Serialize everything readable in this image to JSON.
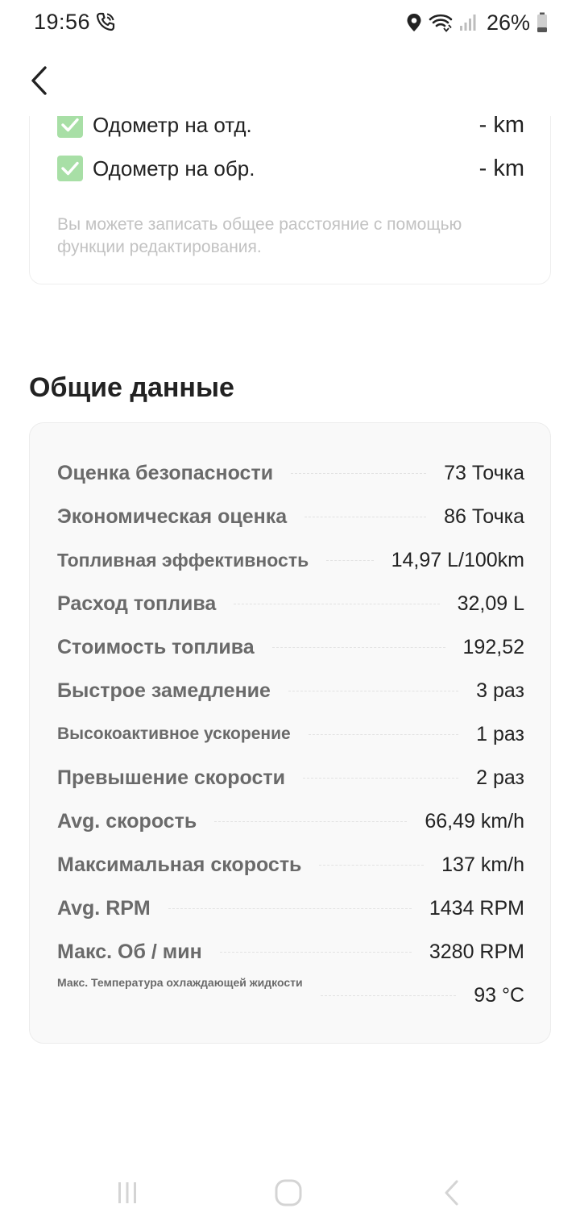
{
  "status_bar": {
    "time": "19:56",
    "battery": "26%"
  },
  "odometer": {
    "rows": [
      {
        "label": "Одометр на отд.",
        "value": "- km"
      },
      {
        "label": "Одометр на обр.",
        "value": "- km"
      }
    ],
    "hint": "Вы можете записать общее расстояние с помощью функции редактирования."
  },
  "general": {
    "title": "Общие данные",
    "rows": [
      {
        "label": "Оценка безопасности",
        "value": "73 Точка"
      },
      {
        "label": "Экономическая оценка",
        "value": "86 Точка"
      },
      {
        "label": "Топливная эффективность",
        "value": "14,97 L/100km"
      },
      {
        "label": "Расход топлива",
        "value": "32,09 L"
      },
      {
        "label": "Стоимость топлива",
        "value": "192,52"
      },
      {
        "label": "Быстрое замедление",
        "value": "3 раз"
      },
      {
        "label": "Высокоактивное ускорение",
        "value": "1 раз"
      },
      {
        "label": "Превышение скорости",
        "value": "2 раз"
      },
      {
        "label": "Avg. скорость",
        "value": "66,49 km/h"
      },
      {
        "label": "Максимальная скорость",
        "value": "137 km/h"
      },
      {
        "label": "Avg. RPM",
        "value": "1434 RPM"
      },
      {
        "label": "Макс. Об / мин",
        "value": "3280 RPM"
      },
      {
        "label": "Макс. Температура охлаждающей жидкости",
        "value": "93 °C"
      }
    ]
  },
  "colors": {
    "check_green": "#a8dfa6",
    "label_gray": "#6a6a6a",
    "hint_gray": "#c2c2c2",
    "card_bg": "#f9f9f9"
  },
  "icons": [
    "call-icon",
    "location-icon",
    "wifi-icon",
    "signal-icon",
    "battery-icon",
    "back-arrow-icon",
    "check-icon",
    "recent-apps-icon",
    "home-icon",
    "nav-back-icon"
  ]
}
